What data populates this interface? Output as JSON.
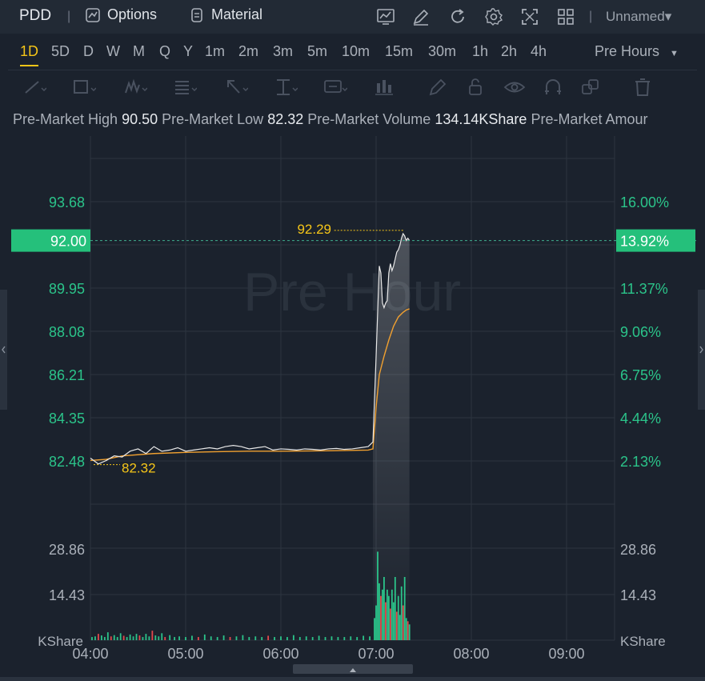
{
  "header": {
    "symbol": "PDD",
    "separator": "|",
    "options_label": "Options",
    "material_label": "Material",
    "layout_name": "Unnamed▾"
  },
  "intervals": {
    "items": [
      "1D",
      "5D",
      "D",
      "W",
      "M",
      "Q",
      "Y",
      "1m",
      "2m",
      "3m",
      "5m",
      "10m",
      "15m",
      "30m",
      "1h",
      "2h",
      "4h"
    ],
    "active": "1D",
    "session_label": "Pre Hours"
  },
  "info": {
    "high_label": "Pre-Market High",
    "high_value": "90.50",
    "low_label": "Pre-Market Low",
    "low_value": "82.32",
    "volume_label": "Pre-Market Volume",
    "volume_value": "134.14KShare",
    "amount_label": "Pre-Market Amour"
  },
  "colors": {
    "bg": "#1b222d",
    "price_line": "#e8e8e8",
    "avg_line": "#f0a030",
    "up": "#2bc48a",
    "down": "#e5484d",
    "accent": "#f5c518"
  },
  "chart_data": {
    "type": "line",
    "watermark": "Pre Hour",
    "current_price": "92.00",
    "current_pct": "13.92%",
    "max_marker": "92.29",
    "min_marker": "82.32",
    "price_ticks": [
      "93.68",
      "89.95",
      "88.08",
      "86.21",
      "84.35",
      "82.48"
    ],
    "price_tick_values": [
      93.68,
      89.95,
      88.08,
      86.21,
      84.35,
      82.48
    ],
    "pct_ticks": [
      "16.00%",
      "11.37%",
      "9.06%",
      "6.75%",
      "4.44%",
      "2.13%"
    ],
    "volume_ticks": [
      "28.86",
      "14.43"
    ],
    "volume_tick_values": [
      28.86,
      14.43
    ],
    "volume_unit": "KShare",
    "time_labels": [
      "04:00",
      "05:00",
      "06:00",
      "07:00",
      "08:00",
      "09:00"
    ],
    "price": [
      [
        0,
        82.6
      ],
      [
        5,
        82.35
      ],
      [
        10,
        82.5
      ],
      [
        15,
        82.7
      ],
      [
        20,
        82.65
      ],
      [
        25,
        82.9
      ],
      [
        30,
        83.0
      ],
      [
        35,
        82.8
      ],
      [
        40,
        83.1
      ],
      [
        45,
        82.9
      ],
      [
        50,
        82.95
      ],
      [
        55,
        83.05
      ],
      [
        60,
        82.9
      ],
      [
        65,
        82.95
      ],
      [
        70,
        83.0
      ],
      [
        75,
        83.05
      ],
      [
        80,
        83.0
      ],
      [
        85,
        83.1
      ],
      [
        90,
        83.15
      ],
      [
        95,
        83.1
      ],
      [
        100,
        83.0
      ],
      [
        105,
        83.05
      ],
      [
        110,
        83.1
      ],
      [
        115,
        82.95
      ],
      [
        120,
        83.0
      ],
      [
        125,
        82.98
      ],
      [
        130,
        82.95
      ],
      [
        135,
        83.0
      ],
      [
        140,
        82.98
      ],
      [
        145,
        82.95
      ],
      [
        150,
        83.0
      ],
      [
        155,
        83.02
      ],
      [
        160,
        82.98
      ],
      [
        165,
        83.0
      ],
      [
        170,
        83.05
      ],
      [
        175,
        83.1
      ],
      [
        178,
        83.3
      ],
      [
        180,
        87.0
      ],
      [
        182,
        90.9
      ],
      [
        183,
        90.6
      ],
      [
        184,
        89.3
      ],
      [
        185,
        89.1
      ],
      [
        186,
        89.3
      ],
      [
        187,
        89.4
      ],
      [
        188,
        90.6
      ],
      [
        189,
        91.0
      ],
      [
        190,
        90.7
      ],
      [
        191,
        90.9
      ],
      [
        192,
        91.2
      ],
      [
        193,
        91.5
      ],
      [
        194,
        91.6
      ],
      [
        195,
        91.8
      ],
      [
        196,
        92.1
      ],
      [
        197,
        92.3
      ],
      [
        198,
        92.2
      ],
      [
        199,
        92.0
      ],
      [
        200,
        92.1
      ],
      [
        201,
        92.0
      ]
    ],
    "average": [
      [
        0,
        82.5
      ],
      [
        10,
        82.55
      ],
      [
        20,
        82.7
      ],
      [
        40,
        82.8
      ],
      [
        60,
        82.85
      ],
      [
        80,
        82.88
      ],
      [
        100,
        82.9
      ],
      [
        120,
        82.9
      ],
      [
        150,
        82.92
      ],
      [
        175,
        82.95
      ],
      [
        178,
        83.0
      ],
      [
        180,
        84.8
      ],
      [
        182,
        86.2
      ],
      [
        185,
        87.0
      ],
      [
        188,
        87.7
      ],
      [
        191,
        88.3
      ],
      [
        194,
        88.7
      ],
      [
        197,
        88.9
      ],
      [
        199,
        89.0
      ],
      [
        201,
        89.05
      ]
    ],
    "volume": [
      [
        1,
        1.0,
        1
      ],
      [
        3,
        1.2,
        1
      ],
      [
        5,
        2.0,
        0
      ],
      [
        7,
        1.5,
        1
      ],
      [
        9,
        1.0,
        1
      ],
      [
        11,
        2.5,
        1
      ],
      [
        13,
        1.2,
        0
      ],
      [
        15,
        1.6,
        1
      ],
      [
        17,
        1.0,
        1
      ],
      [
        19,
        2.2,
        1
      ],
      [
        21,
        1.4,
        0
      ],
      [
        23,
        1.0,
        1
      ],
      [
        25,
        1.8,
        1
      ],
      [
        27,
        1.2,
        1
      ],
      [
        29,
        2.0,
        1
      ],
      [
        31,
        1.5,
        0
      ],
      [
        33,
        1.0,
        1
      ],
      [
        35,
        2.0,
        1
      ],
      [
        37,
        1.2,
        1
      ],
      [
        39,
        3.0,
        0
      ],
      [
        41,
        1.5,
        1
      ],
      [
        43,
        1.2,
        1
      ],
      [
        45,
        2.2,
        1
      ],
      [
        47,
        1.0,
        0
      ],
      [
        50,
        1.6,
        1
      ],
      [
        53,
        1.0,
        1
      ],
      [
        56,
        1.2,
        1
      ],
      [
        60,
        1.0,
        1
      ],
      [
        64,
        1.4,
        1
      ],
      [
        68,
        1.0,
        0
      ],
      [
        72,
        1.8,
        1
      ],
      [
        76,
        1.2,
        1
      ],
      [
        80,
        1.0,
        1
      ],
      [
        84,
        1.5,
        1
      ],
      [
        88,
        1.0,
        0
      ],
      [
        92,
        1.2,
        1
      ],
      [
        96,
        1.6,
        1
      ],
      [
        100,
        1.0,
        1
      ],
      [
        104,
        1.2,
        1
      ],
      [
        108,
        1.0,
        1
      ],
      [
        112,
        1.4,
        0
      ],
      [
        116,
        1.0,
        1
      ],
      [
        120,
        1.2,
        1
      ],
      [
        124,
        1.0,
        1
      ],
      [
        128,
        1.6,
        1
      ],
      [
        132,
        1.0,
        1
      ],
      [
        136,
        1.2,
        1
      ],
      [
        140,
        1.0,
        1
      ],
      [
        144,
        1.4,
        1
      ],
      [
        148,
        1.0,
        1
      ],
      [
        152,
        1.2,
        1
      ],
      [
        156,
        1.0,
        1
      ],
      [
        160,
        1.0,
        1
      ],
      [
        164,
        1.2,
        1
      ],
      [
        168,
        1.0,
        1
      ],
      [
        172,
        1.4,
        1
      ],
      [
        176,
        1.2,
        1
      ],
      [
        179,
        7.0,
        1
      ],
      [
        180,
        11.0,
        1
      ],
      [
        181,
        28.0,
        1
      ],
      [
        182,
        18.0,
        1
      ],
      [
        183,
        14.0,
        0
      ],
      [
        184,
        16.0,
        1
      ],
      [
        185,
        20.0,
        1
      ],
      [
        186,
        12.0,
        0
      ],
      [
        187,
        16.0,
        1
      ],
      [
        188,
        14.0,
        1
      ],
      [
        189,
        10.0,
        0
      ],
      [
        190,
        16.0,
        1
      ],
      [
        191,
        12.0,
        1
      ],
      [
        192,
        20.0,
        1
      ],
      [
        193,
        9.0,
        0
      ],
      [
        194,
        14.0,
        1
      ],
      [
        195,
        8.0,
        1
      ],
      [
        196,
        17.0,
        1
      ],
      [
        197,
        11.0,
        0
      ],
      [
        198,
        20.0,
        1
      ],
      [
        199,
        7.0,
        1
      ],
      [
        200,
        6.0,
        0
      ],
      [
        201,
        5.0,
        1
      ]
    ]
  }
}
